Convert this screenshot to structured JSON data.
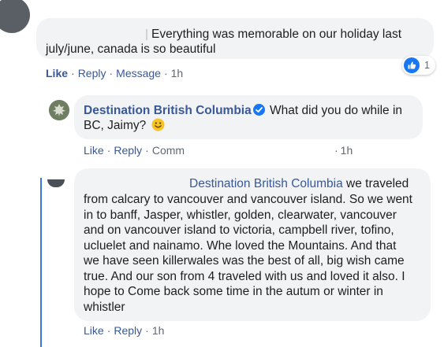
{
  "comment1": {
    "text_line1": "Everything was memorable on our holiday last",
    "text_line2": "july/june, canada is so beautiful",
    "reaction_count": "1",
    "actions": {
      "like": "Like",
      "reply": "Reply",
      "message": "Message",
      "time": "1h"
    }
  },
  "reply1": {
    "author": "Destination British Columbia",
    "text_inline": "What did you do while in",
    "text_line2": "BC, Jaimy?",
    "emoji": "🙂",
    "actions": {
      "like": "Like",
      "reply": "Reply",
      "comment": "Comm",
      "time": "1h"
    }
  },
  "reply2": {
    "mention": "Destination British Columbia",
    "lines": [
      "we traveled",
      "from calcary to vancouver and vancouver island. So we went",
      "in to banff, Jasper, whistler, golden, clearwater, vancouver",
      "and on vancouver island to victoria, campbell river, tofino,",
      "ucluelet and nainamo. Whe loved the Mountains. And that",
      "we have seen killerwales was the best of all, big wish came",
      "true. And our son from 4 traveled with us and loved it also. I",
      "hope to Come back some time in the autum or winter in",
      "whistler"
    ],
    "actions": {
      "like": "Like",
      "reply": "Reply",
      "time": "1h"
    }
  },
  "colors": {
    "link": "#385898",
    "bubble": "#f2f3f5",
    "verified": "#1877f2",
    "thread_line": "#3578e5"
  }
}
